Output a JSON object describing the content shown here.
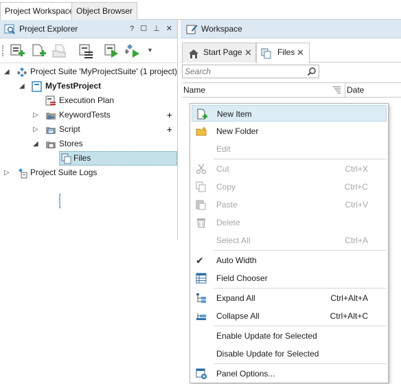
{
  "top_tabs": [
    "Project Workspace",
    "Object Browser"
  ],
  "explorer": {
    "title": "Project Explorer",
    "controls": "? ☐ ⊥ ✕"
  },
  "tree": [
    {
      "label": "Project Suite 'MyProjectSuite' (1 project)"
    },
    {
      "label": "MyTestProject"
    },
    {
      "label": "Execution Plan"
    },
    {
      "label": "KeywordTests"
    },
    {
      "label": "Script"
    },
    {
      "label": "Stores"
    },
    {
      "label": "Files"
    },
    {
      "label": "Project Suite Logs"
    }
  ],
  "workspace": {
    "title": "Workspace",
    "tabs": [
      "Start Page",
      "Files"
    ],
    "search_placeholder": "Search",
    "columns": [
      "Name",
      "Date"
    ]
  },
  "menu": [
    {
      "label": "New Item",
      "shortcut": ""
    },
    {
      "label": "New Folder",
      "shortcut": ""
    },
    {
      "label": "Edit",
      "shortcut": ""
    },
    {
      "label": "Cut",
      "shortcut": "Ctrl+X"
    },
    {
      "label": "Copy",
      "shortcut": "Ctrl+C"
    },
    {
      "label": "Paste",
      "shortcut": "Ctrl+V"
    },
    {
      "label": "Delete",
      "shortcut": ""
    },
    {
      "label": "Select All",
      "shortcut": "Ctrl+A"
    },
    {
      "label": "Auto Width",
      "shortcut": ""
    },
    {
      "label": "Field Chooser",
      "shortcut": ""
    },
    {
      "label": "Expand All",
      "shortcut": "Ctrl+Alt+A"
    },
    {
      "label": "Collapse All",
      "shortcut": "Ctrl+Alt+C"
    },
    {
      "label": "Enable Update for Selected",
      "shortcut": ""
    },
    {
      "label": "Disable Update for Selected",
      "shortcut": ""
    },
    {
      "label": "Panel Options...",
      "shortcut": ""
    }
  ],
  "colors": {
    "accent": "#2e8bc0",
    "highlight": "#c5e1ea",
    "green": "#2fa82f"
  }
}
